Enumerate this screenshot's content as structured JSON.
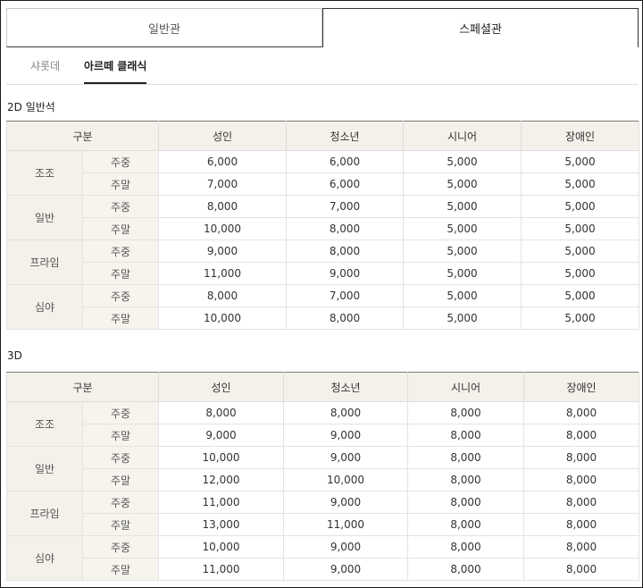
{
  "tabs": {
    "general": "일반관",
    "special": "스페셜관"
  },
  "subtabs": [
    "샤롯데",
    "아르떼 클래식"
  ],
  "headers": {
    "category": "구분",
    "adult": "성인",
    "youth": "청소년",
    "senior": "시니어",
    "disabled": "장애인"
  },
  "sections": [
    {
      "title": "2D 일반석",
      "groups": [
        {
          "name": "조조",
          "rows": [
            {
              "day": "주중",
              "adult": "6,000",
              "youth": "6,000",
              "senior": "5,000",
              "disabled": "5,000"
            },
            {
              "day": "주말",
              "adult": "7,000",
              "youth": "6,000",
              "senior": "5,000",
              "disabled": "5,000"
            }
          ]
        },
        {
          "name": "일반",
          "rows": [
            {
              "day": "주중",
              "adult": "8,000",
              "youth": "7,000",
              "senior": "5,000",
              "disabled": "5,000"
            },
            {
              "day": "주말",
              "adult": "10,000",
              "youth": "8,000",
              "senior": "5,000",
              "disabled": "5,000"
            }
          ]
        },
        {
          "name": "프라임",
          "rows": [
            {
              "day": "주중",
              "adult": "9,000",
              "youth": "8,000",
              "senior": "5,000",
              "disabled": "5,000"
            },
            {
              "day": "주말",
              "adult": "11,000",
              "youth": "9,000",
              "senior": "5,000",
              "disabled": "5,000"
            }
          ]
        },
        {
          "name": "심야",
          "rows": [
            {
              "day": "주중",
              "adult": "8,000",
              "youth": "7,000",
              "senior": "5,000",
              "disabled": "5,000"
            },
            {
              "day": "주말",
              "adult": "10,000",
              "youth": "8,000",
              "senior": "5,000",
              "disabled": "5,000"
            }
          ]
        }
      ]
    },
    {
      "title": "3D",
      "groups": [
        {
          "name": "조조",
          "rows": [
            {
              "day": "주중",
              "adult": "8,000",
              "youth": "8,000",
              "senior": "8,000",
              "disabled": "8,000"
            },
            {
              "day": "주말",
              "adult": "9,000",
              "youth": "9,000",
              "senior": "8,000",
              "disabled": "8,000"
            }
          ]
        },
        {
          "name": "일반",
          "rows": [
            {
              "day": "주중",
              "adult": "10,000",
              "youth": "9,000",
              "senior": "8,000",
              "disabled": "8,000"
            },
            {
              "day": "주말",
              "adult": "12,000",
              "youth": "10,000",
              "senior": "8,000",
              "disabled": "8,000"
            }
          ]
        },
        {
          "name": "프라임",
          "rows": [
            {
              "day": "주중",
              "adult": "11,000",
              "youth": "9,000",
              "senior": "8,000",
              "disabled": "8,000"
            },
            {
              "day": "주말",
              "adult": "13,000",
              "youth": "11,000",
              "senior": "8,000",
              "disabled": "8,000"
            }
          ]
        },
        {
          "name": "심야",
          "rows": [
            {
              "day": "주중",
              "adult": "10,000",
              "youth": "9,000",
              "senior": "8,000",
              "disabled": "8,000"
            },
            {
              "day": "주말",
              "adult": "11,000",
              "youth": "9,000",
              "senior": "8,000",
              "disabled": "8,000"
            }
          ]
        }
      ]
    }
  ]
}
